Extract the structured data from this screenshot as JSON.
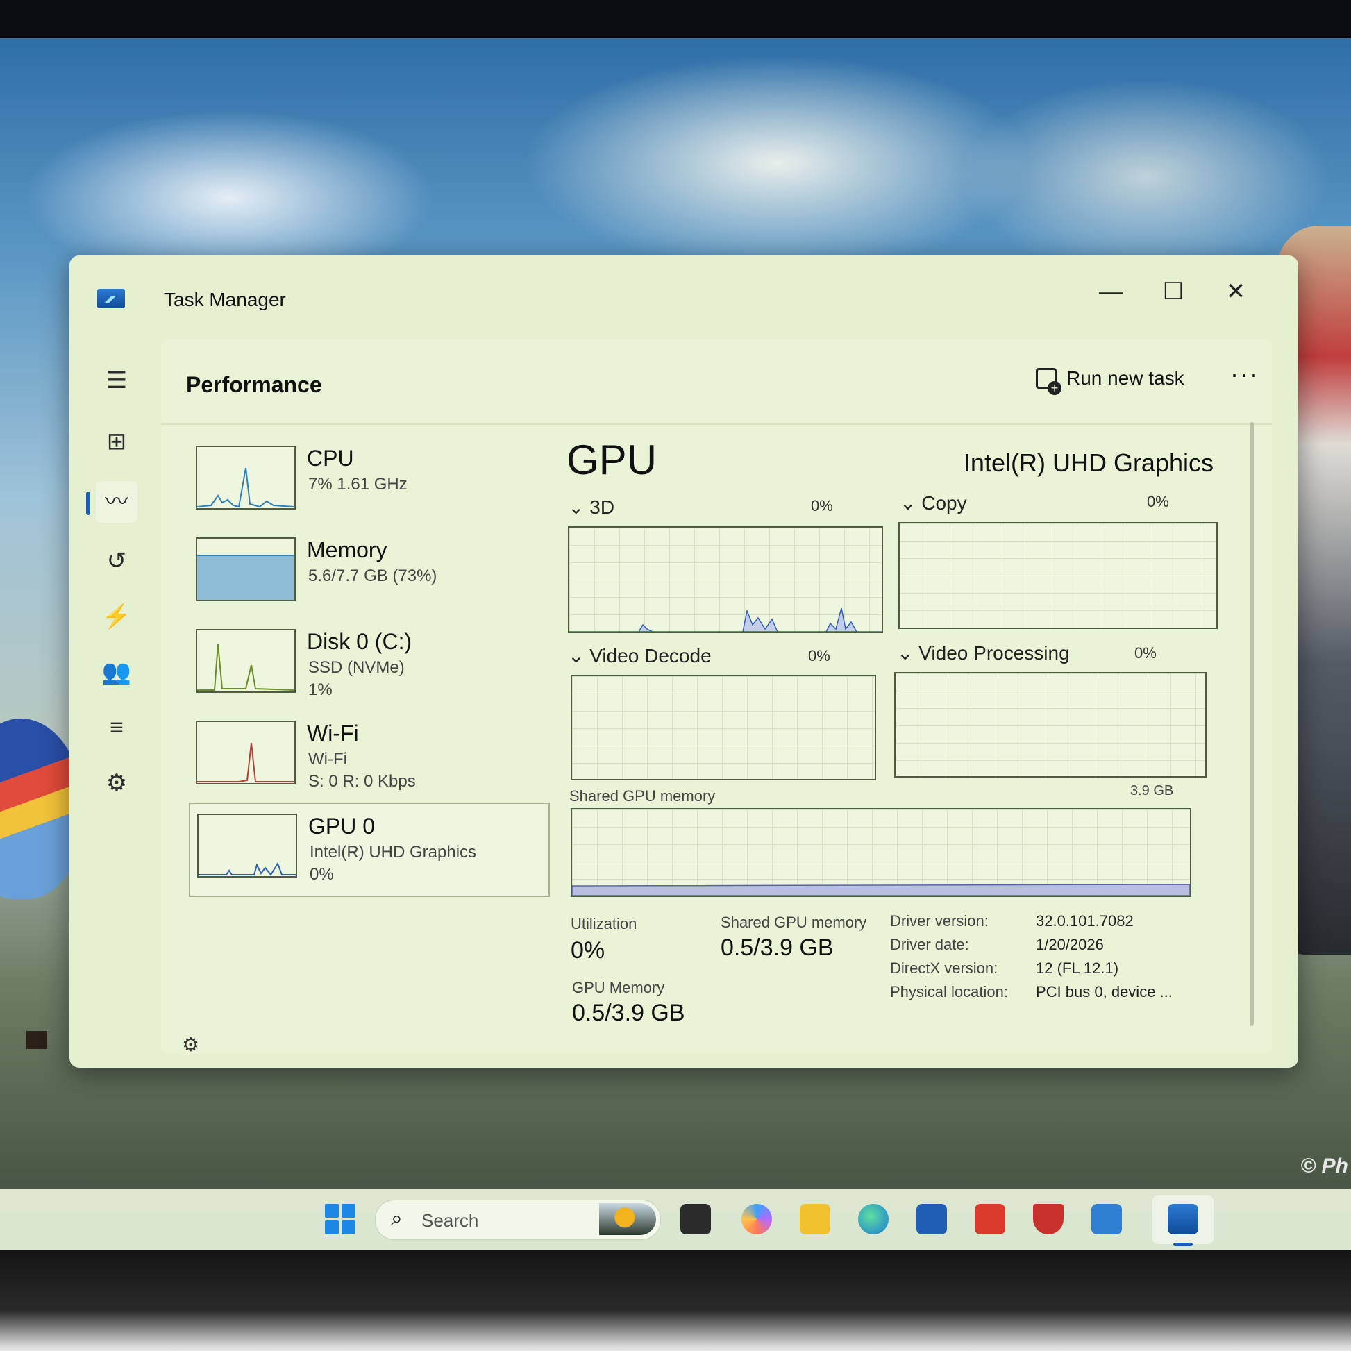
{
  "window": {
    "title": "Task Manager",
    "controls": [
      "—",
      "☐",
      "✕"
    ]
  },
  "header": {
    "page_title": "Performance",
    "run_new_task_label": "Run new task",
    "more_label": "···"
  },
  "devices": [
    {
      "name": "CPU",
      "line1": "7%  1.61 GHz",
      "line2": "",
      "color": "#2f7fb8"
    },
    {
      "name": "Memory",
      "line1": "5.6/7.7 GB (73%)",
      "line2": "",
      "color": "#8fbcd6"
    },
    {
      "name": "Disk 0 (C:)",
      "line1": "SSD (NVMe)",
      "line2": "1%",
      "color": "#6b8e23"
    },
    {
      "name": "Wi-Fi",
      "line1": "Wi-Fi",
      "line2": "S: 0  R: 0 Kbps",
      "color": "#b5423a"
    },
    {
      "name": "GPU 0",
      "line1": "Intel(R) UHD Graphics",
      "line2": "0%",
      "color": "#2f5fb8",
      "selected": true
    }
  ],
  "gpu": {
    "title": "GPU",
    "model": "Intel(R) UHD Graphics",
    "engines": [
      {
        "label": "3D",
        "pct": "0%"
      },
      {
        "label": "Copy",
        "pct": "0%"
      },
      {
        "label": "Video Decode",
        "pct": "0%"
      },
      {
        "label": "Video Processing",
        "pct": "0%"
      }
    ],
    "shared_memory_graph": {
      "label": "Shared GPU memory",
      "max": "3.9 GB"
    },
    "stats": {
      "utilization_label": "Utilization",
      "utilization_value": "0%",
      "shared_label": "Shared GPU memory",
      "shared_value": "0.5/3.9 GB",
      "gpu_memory_label": "GPU Memory",
      "gpu_memory_value": "0.5/3.9 GB"
    },
    "info": [
      {
        "k": "Driver version:",
        "v": "32.0.101.7082"
      },
      {
        "k": "Driver date:",
        "v": "1/20/2026"
      },
      {
        "k": "DirectX version:",
        "v": "12 (FL 12.1)"
      },
      {
        "k": "Physical location:",
        "v": "PCI bus 0, device ..."
      }
    ]
  },
  "taskbar": {
    "search_placeholder": "Search"
  },
  "wallpaper": {
    "credit": "© Ph"
  },
  "colors": {
    "accent": "#1b5fb3",
    "window_bg": "#e4f0cf"
  }
}
